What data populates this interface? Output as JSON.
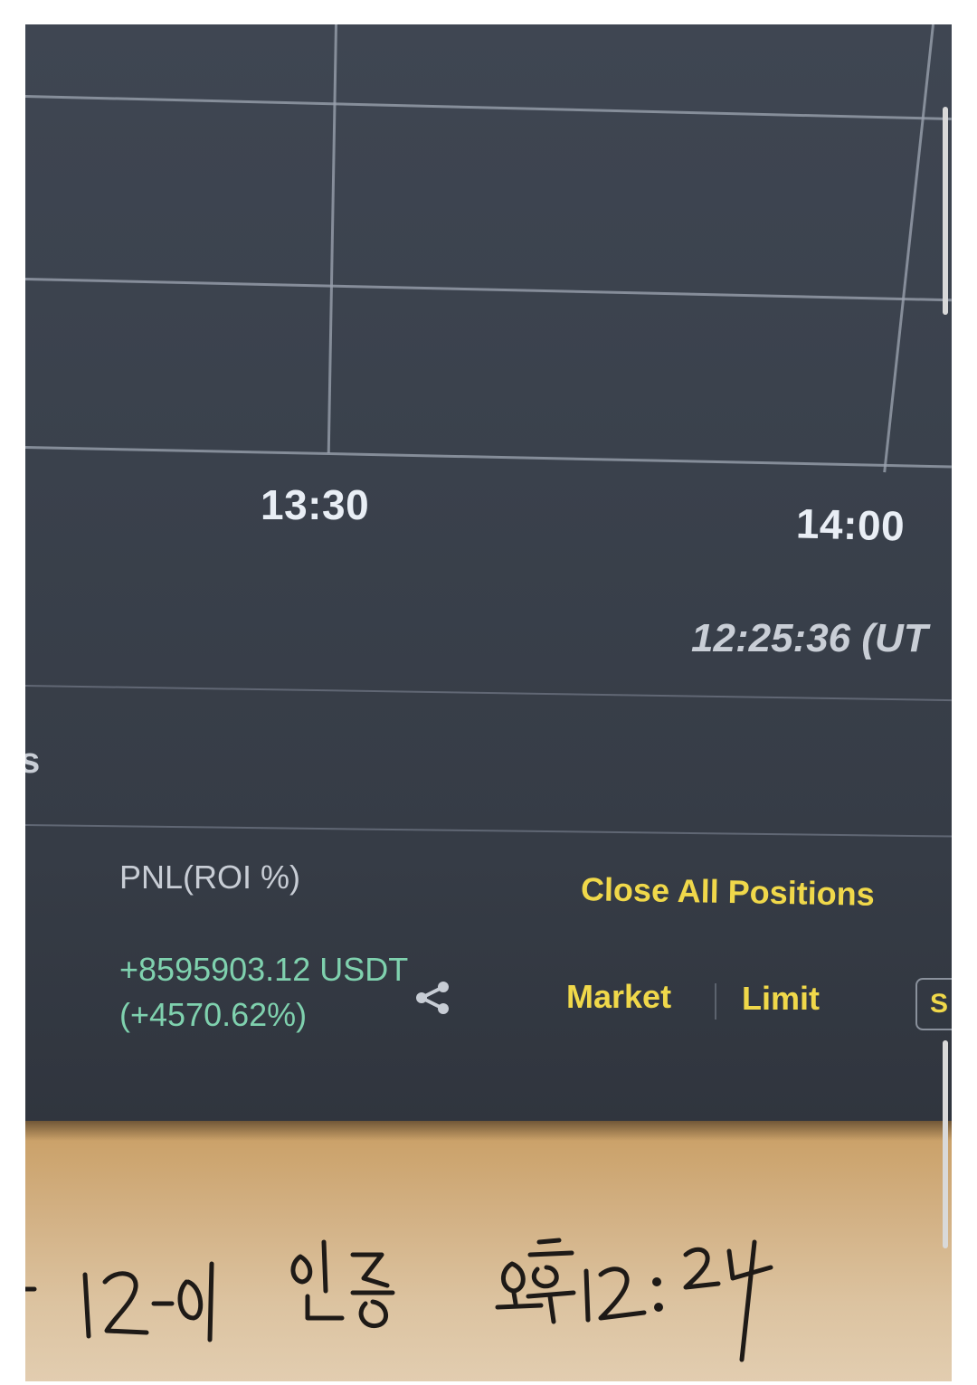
{
  "chart": {
    "time_labels": [
      "13:30",
      "14:00"
    ],
    "clock": "12:25:36 (UT"
  },
  "left_edge_glyph": "s",
  "position": {
    "pnl_header": "PNL(ROI %)",
    "pnl_value": "+8595903.12 USDT",
    "roi_value": "(+4570.62%)"
  },
  "actions": {
    "close_all": "Close All Positions",
    "market": "Market",
    "limit": "Limit",
    "cut_button": "S"
  },
  "handwritten_note": "12-01 인증 오후12:24",
  "colors": {
    "profit": "#7fd1ae",
    "accent": "#f0d84a",
    "screen_bg": "#3a414c"
  },
  "icons": {
    "share": "share-icon"
  }
}
